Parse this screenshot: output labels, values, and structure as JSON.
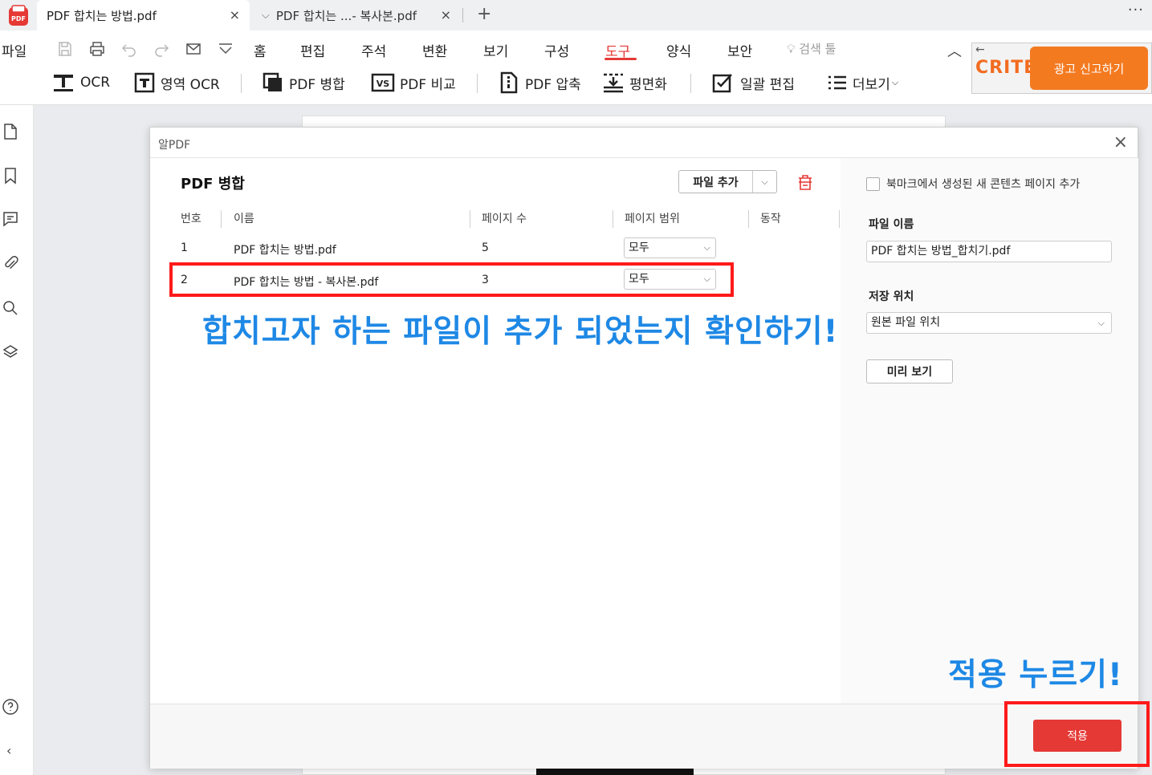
{
  "tabs": [
    {
      "label": "PDF 합치는 방법.pdf",
      "close": "×"
    },
    {
      "label": "PDF 합치는 ...- 복사본.pdf",
      "close": "×"
    }
  ],
  "tab_add": "+",
  "more": "···",
  "menu": {
    "file": "파일",
    "items": [
      "홈",
      "편집",
      "주석",
      "변환",
      "보기",
      "구성",
      "도구",
      "양식",
      "보안"
    ],
    "active": "도구",
    "search_tool": "검색 툴"
  },
  "tools": {
    "ocr": "OCR",
    "area_ocr": "영역 OCR",
    "merge": "PDF 병합",
    "compare": "PDF 비교",
    "compress": "PDF 압축",
    "flatten": "평면화",
    "batch": "일괄 편집",
    "more": "더보기"
  },
  "ad": {
    "back": "←",
    "brand": "CRITEO",
    "report": "광고 신고하기"
  },
  "dialog": {
    "title": "알PDF",
    "close": "×",
    "section_title": "PDF 병합",
    "add_file": "파일 추가",
    "columns": [
      "번호",
      "이름",
      "페이지 수",
      "페이지 범위",
      "동작"
    ],
    "rows": [
      {
        "no": "1",
        "name": "PDF 합치는 방법.pdf",
        "pages": "5",
        "range": "모두"
      },
      {
        "no": "2",
        "name": "PDF 합치는 방법 - 복사본.pdf",
        "pages": "3",
        "range": "모두"
      }
    ],
    "bookmark_option": "북마크에서 생성된 새 콘텐츠 페이지 추가",
    "file_name_label": "파일 이름",
    "file_name_value": "PDF 합치는 방법_합치기.pdf",
    "save_location_label": "저장 위치",
    "save_location_value": "원본 파일 위치",
    "preview": "미리 보기",
    "apply": "적용"
  },
  "annotations": {
    "check_files": "합치고자 하는 파일이 추가 되었는지 확인하기!",
    "press_apply": "적용 누르기!"
  },
  "colors": {
    "accent_red": "#e53935",
    "annotation_blue": "#1e88e5",
    "highlight_red": "#ff1a1a",
    "ad_orange": "#f47a20"
  }
}
